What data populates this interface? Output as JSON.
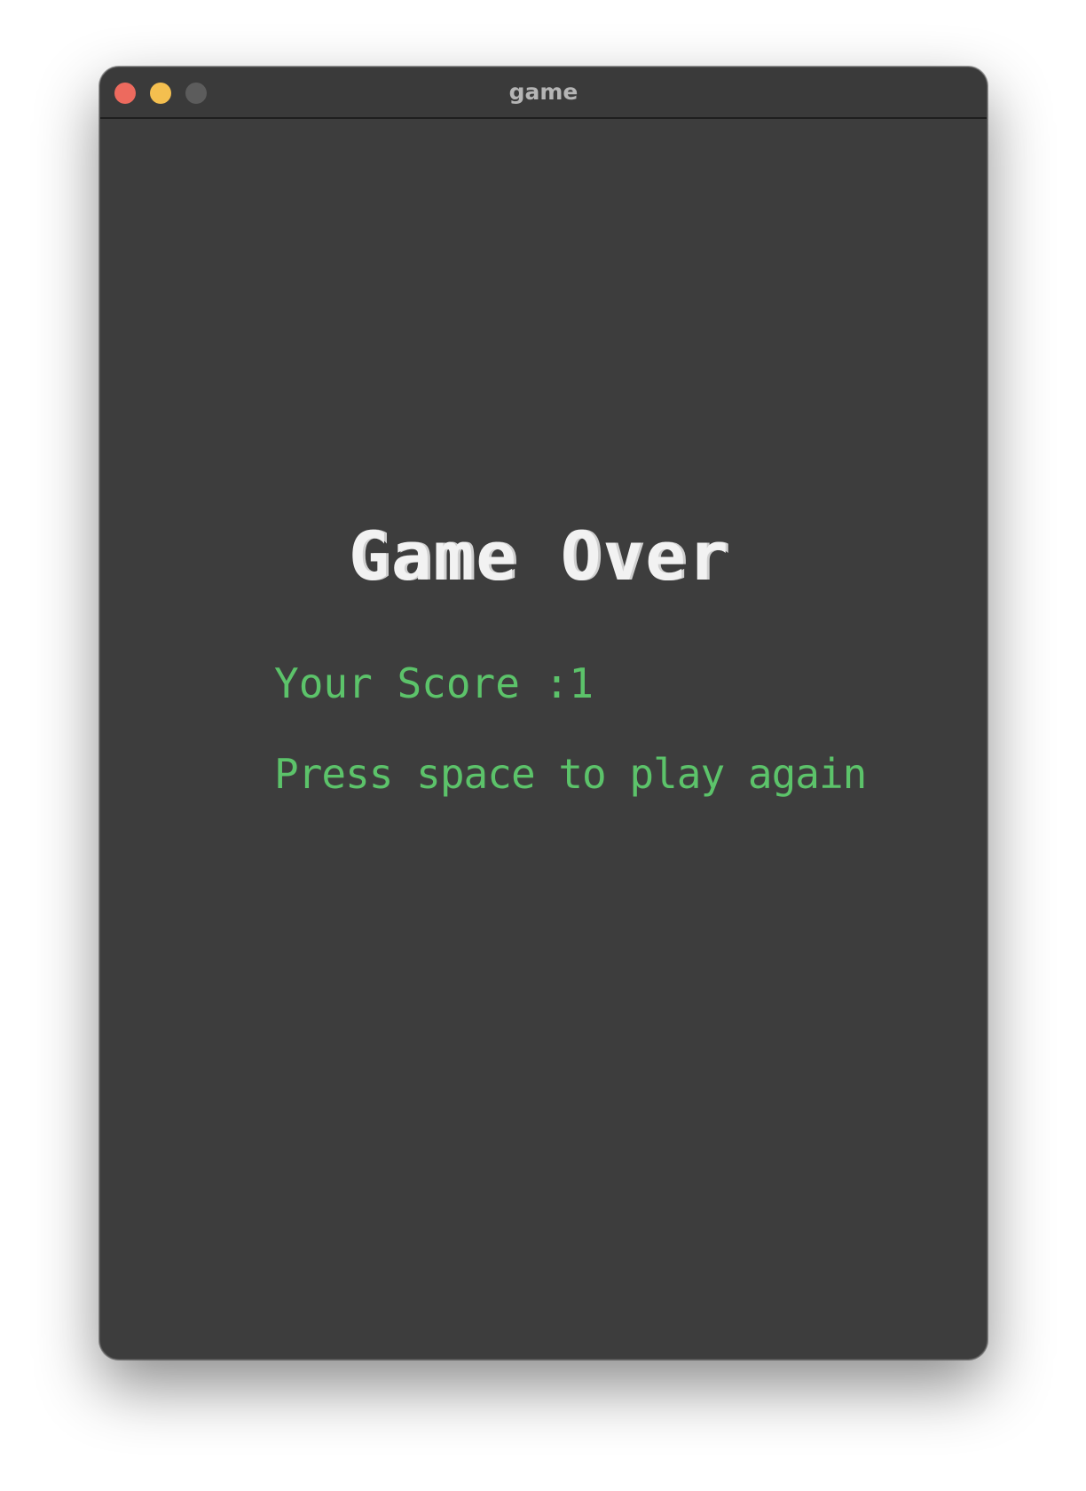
{
  "window": {
    "title": "game"
  },
  "game_over": {
    "title": "Game Over",
    "score_label": "Your Score",
    "score_separator": ":",
    "score_value": "1",
    "prompt": "Press space to play again"
  },
  "colors": {
    "background": "#3d3d3d",
    "title_text": "#f2f2f2",
    "accent_text": "#5cc36a",
    "close": "#ed6a5e",
    "minimize": "#f4bf4f",
    "zoom_disabled": "#5c5c5c"
  }
}
